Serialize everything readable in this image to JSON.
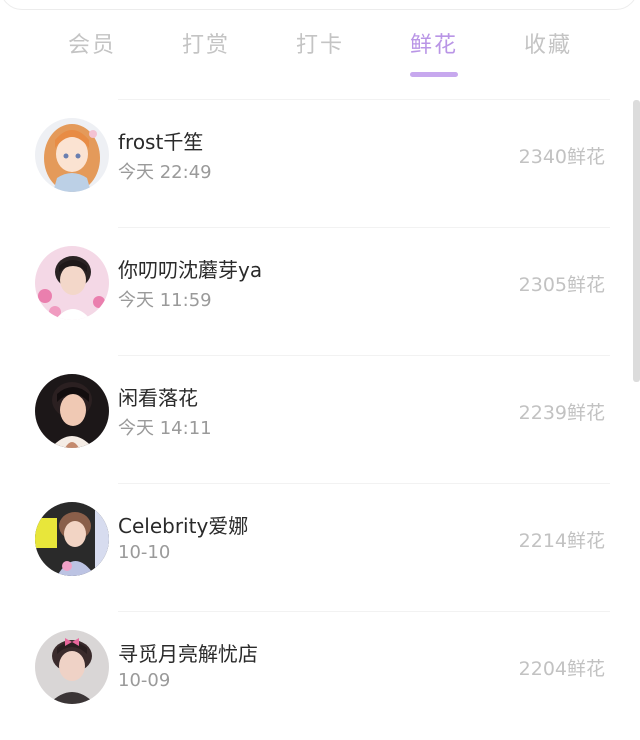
{
  "tabs": [
    {
      "label": "会员",
      "active": false
    },
    {
      "label": "打赏",
      "active": false
    },
    {
      "label": "打卡",
      "active": false
    },
    {
      "label": "鲜花",
      "active": true
    },
    {
      "label": "收藏",
      "active": false
    }
  ],
  "accent_color": "#b995e6",
  "rows": [
    {
      "name": "frost千笙",
      "time": "今天 22:49",
      "amount": "2340鲜花",
      "avatar": "anime-girl-avatar"
    },
    {
      "name": "你叨叨沈蘑芽ya",
      "time": "今天 11:59",
      "amount": "2305鲜花",
      "avatar": "boy-pink-background-avatar"
    },
    {
      "name": "闲看落花",
      "time": "今天 14:11",
      "amount": "2239鲜花",
      "avatar": "boy-dark-background-avatar"
    },
    {
      "name": "Celebrity爱娜",
      "time": "10-10",
      "amount": "2214鲜花",
      "avatar": "boy-yellow-light-avatar"
    },
    {
      "name": "寻觅月亮解忧店",
      "time": "10-09",
      "amount": "2204鲜花",
      "avatar": "boy-pink-bow-avatar"
    }
  ]
}
